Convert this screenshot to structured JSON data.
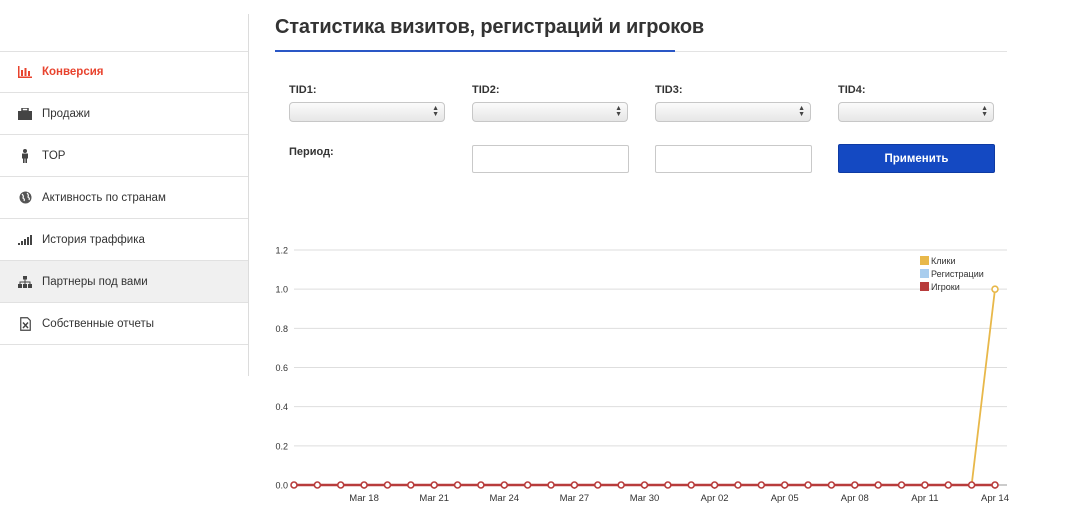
{
  "sidebar": {
    "items": [
      {
        "label": "Конверсия",
        "icon": "bar-chart-icon",
        "active": true
      },
      {
        "label": "Продажи",
        "icon": "briefcase-icon"
      },
      {
        "label": "TOP",
        "icon": "person-icon"
      },
      {
        "label": "Активность по странам",
        "icon": "globe-icon"
      },
      {
        "label": "История траффика",
        "icon": "signal-icon"
      },
      {
        "label": "Партнеры под вами",
        "icon": "sitemap-icon",
        "hover": true
      },
      {
        "label": "Собственные отчеты",
        "icon": "excel-file-icon"
      }
    ]
  },
  "header": {
    "title": "Статистика визитов, регистраций и игроков"
  },
  "filters": {
    "tid1_label": "TID1:",
    "tid2_label": "TID2:",
    "tid3_label": "TID3:",
    "tid4_label": "TID4:",
    "tid1_value": "",
    "tid2_value": "",
    "tid3_value": "",
    "tid4_value": "",
    "period_label": "Период:",
    "date_from": "",
    "date_to": "",
    "apply_label": "Применить"
  },
  "colors": {
    "accent": "#e8432e",
    "primary": "#1449c2",
    "clicks": "#e8b84a",
    "registrations": "#a8cdee",
    "players": "#b83c3c"
  },
  "chart_data": {
    "type": "line",
    "x": [
      "Mar 15",
      "Mar 16",
      "Mar 17",
      "Mar 18",
      "Mar 19",
      "Mar 20",
      "Mar 21",
      "Mar 22",
      "Mar 23",
      "Mar 24",
      "Mar 25",
      "Mar 26",
      "Mar 27",
      "Mar 28",
      "Mar 29",
      "Mar 30",
      "Mar 31",
      "Apr 01",
      "Apr 02",
      "Apr 03",
      "Apr 04",
      "Apr 05",
      "Apr 06",
      "Apr 07",
      "Apr 08",
      "Apr 09",
      "Apr 10",
      "Apr 11",
      "Apr 12",
      "Apr 13",
      "Apr 14"
    ],
    "xticks": [
      "Mar 18",
      "Mar 21",
      "Mar 24",
      "Mar 27",
      "Mar 30",
      "Apr 02",
      "Apr 05",
      "Apr 08",
      "Apr 11",
      "Apr 14"
    ],
    "yticks": [
      "0.0",
      "0.2",
      "0.4",
      "0.6",
      "0.8",
      "1.0",
      "1.2"
    ],
    "ylim": [
      0,
      1.2
    ],
    "legend_position": "top-right",
    "grid": true,
    "series": [
      {
        "name": "Клики",
        "color": "#e8b84a",
        "values": [
          0,
          0,
          0,
          0,
          0,
          0,
          0,
          0,
          0,
          0,
          0,
          0,
          0,
          0,
          0,
          0,
          0,
          0,
          0,
          0,
          0,
          0,
          0,
          0,
          0,
          0,
          0,
          0,
          0,
          0,
          1
        ]
      },
      {
        "name": "Регистрации",
        "color": "#a8cdee",
        "values": [
          0,
          0,
          0,
          0,
          0,
          0,
          0,
          0,
          0,
          0,
          0,
          0,
          0,
          0,
          0,
          0,
          0,
          0,
          0,
          0,
          0,
          0,
          0,
          0,
          0,
          0,
          0,
          0,
          0,
          0,
          0
        ]
      },
      {
        "name": "Игроки",
        "color": "#b83c3c",
        "values": [
          0,
          0,
          0,
          0,
          0,
          0,
          0,
          0,
          0,
          0,
          0,
          0,
          0,
          0,
          0,
          0,
          0,
          0,
          0,
          0,
          0,
          0,
          0,
          0,
          0,
          0,
          0,
          0,
          0,
          0,
          0
        ]
      }
    ]
  }
}
